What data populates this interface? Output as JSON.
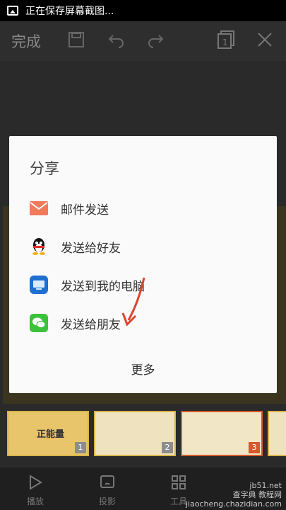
{
  "status_bar": {
    "text": "正在保存屏幕截图..."
  },
  "toolbar": {
    "done_label": "完成"
  },
  "dialog": {
    "title": "分享",
    "items": [
      {
        "label": "邮件发送",
        "icon": "mail-icon"
      },
      {
        "label": "发送给好友",
        "icon": "qq-icon"
      },
      {
        "label": "发送到我的电脑",
        "icon": "computer-icon"
      },
      {
        "label": "发送给朋友",
        "icon": "wechat-icon"
      }
    ],
    "more_label": "更多"
  },
  "thumbnails": [
    {
      "num": "1",
      "text": "正能量",
      "active": false
    },
    {
      "num": "2",
      "text": "",
      "active": false
    },
    {
      "num": "3",
      "text": "",
      "active": true
    }
  ],
  "bottom_nav": [
    {
      "label": "播放",
      "icon": "play-icon"
    },
    {
      "label": "投影",
      "icon": "projection-icon"
    },
    {
      "label": "工具",
      "icon": "grid-icon"
    }
  ],
  "watermark": {
    "line1": "jb51.net",
    "line2": "查字典 教程网",
    "line3": "jiaocheng.chazidian.com"
  },
  "colors": {
    "mail": "#f07a5a",
    "computer": "#1e6fd0",
    "wechat": "#3cc13b",
    "accent": "#d35a2e"
  }
}
